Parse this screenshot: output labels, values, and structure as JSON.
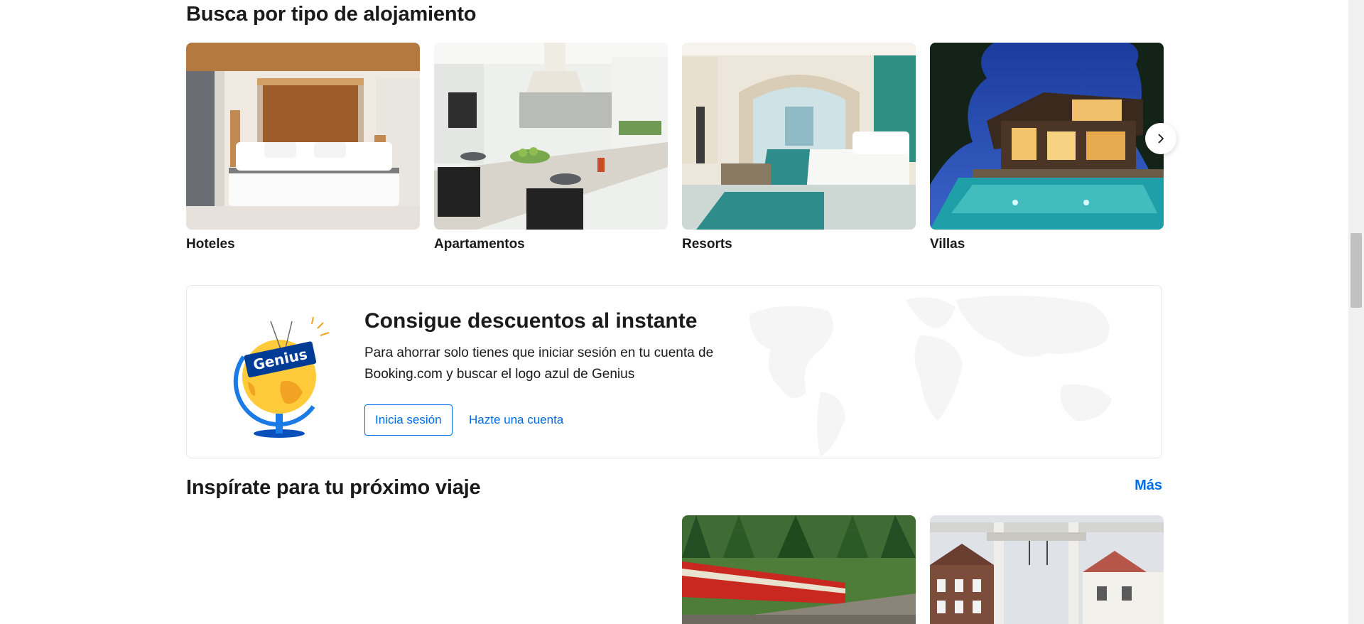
{
  "property_types": {
    "title": "Busca por tipo de alojamiento",
    "items": [
      {
        "label": "Hoteles",
        "image_icon": "hotel-room-photo"
      },
      {
        "label": "Apartamentos",
        "image_icon": "apartment-kitchen-photo"
      },
      {
        "label": "Resorts",
        "image_icon": "resort-room-photo"
      },
      {
        "label": "Villas",
        "image_icon": "villa-pool-photo"
      }
    ],
    "next_icon": "chevron-right-icon"
  },
  "genius": {
    "badge_text": "Genius",
    "title": "Consigue descuentos al instante",
    "text": "Para ahorrar solo tienes que iniciar sesión en tu cuenta de Booking.com y buscar el logo azul de Genius",
    "signin_label": "Inicia sesión",
    "register_label": "Hazte una cuenta"
  },
  "inspiration": {
    "title": "Inspírate para tu próximo viaje",
    "more_label": "Más",
    "items": [
      {
        "image_icon": "train-forest-photo"
      },
      {
        "image_icon": "canal-bridge-photo"
      }
    ]
  },
  "colors": {
    "accent": "#006ce4",
    "text": "#1a1a1a",
    "genius_blue": "#003b95",
    "genius_yellow": "#febb02"
  }
}
